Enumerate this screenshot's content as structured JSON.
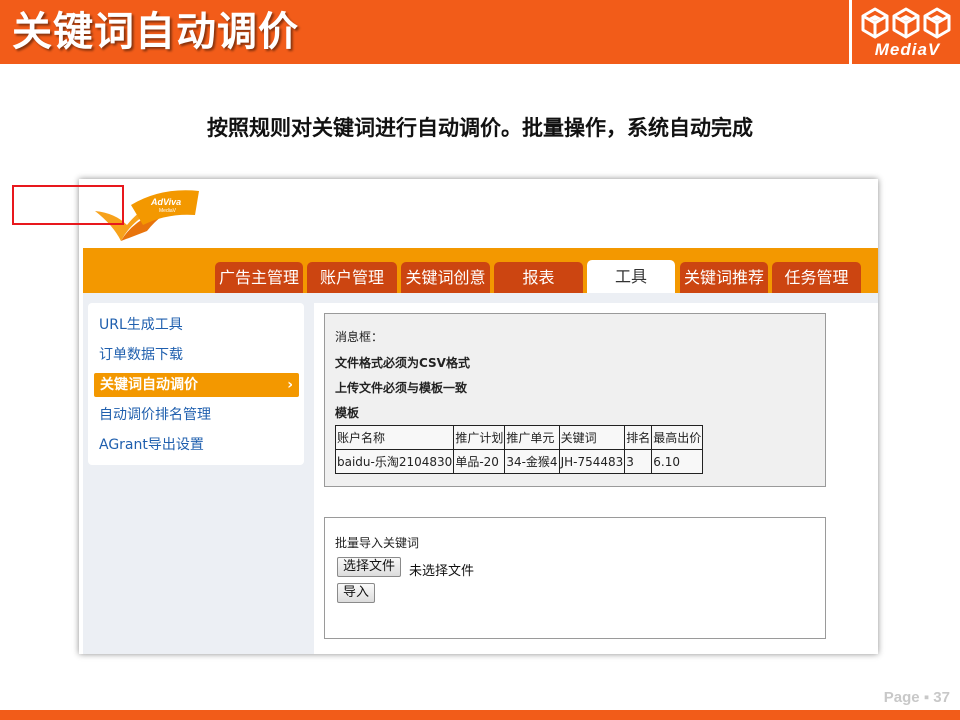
{
  "slide": {
    "title": "关键词自动调价",
    "logo_text": "MediaV",
    "subtitle": "按照规则对关键词进行自动调价。批量操作，系统自动完成",
    "page_label": "Page ▪ 37"
  },
  "app": {
    "brand": {
      "name": "AdViva",
      "sub": "MediaV"
    },
    "tabs": [
      {
        "label": "广告主管理",
        "active": false
      },
      {
        "label": "账户管理",
        "active": false
      },
      {
        "label": "关键词创意",
        "active": false
      },
      {
        "label": "报表",
        "active": false
      },
      {
        "label": "工具",
        "active": true
      },
      {
        "label": "关键词推荐",
        "active": false
      },
      {
        "label": "任务管理",
        "active": false
      }
    ],
    "sidebar": {
      "items": [
        {
          "label": "URL生成工具"
        },
        {
          "label": "订单数据下载"
        },
        {
          "label": "关键词自动调价",
          "active": true
        },
        {
          "label": "自动调价排名管理"
        },
        {
          "label": "AGrant导出设置"
        }
      ],
      "active_arrow": "›"
    },
    "message_box": {
      "heading": "消息框：",
      "line1": "文件格式必须为CSV格式",
      "line2": "上传文件必须与模板一致",
      "template_label": "模板",
      "table": {
        "headers": [
          "账户名称",
          "推广计划",
          "推广单元",
          "关键词",
          "排名",
          "最高出价"
        ],
        "row": [
          "baidu-乐淘2104830",
          "单品-20",
          "34-金猴4",
          "JH-754483",
          "3",
          "6.10"
        ]
      }
    },
    "import_box": {
      "label": "批量导入关键词",
      "choose_file_button": "选择文件",
      "file_status": "未选择文件",
      "import_button": "导入"
    }
  },
  "colors": {
    "slide_orange": "#f25c19",
    "nav_orange": "#f39800",
    "tab_red": "#cc4511",
    "highlight_red": "#e8181d",
    "link_blue": "#1f5fae"
  }
}
